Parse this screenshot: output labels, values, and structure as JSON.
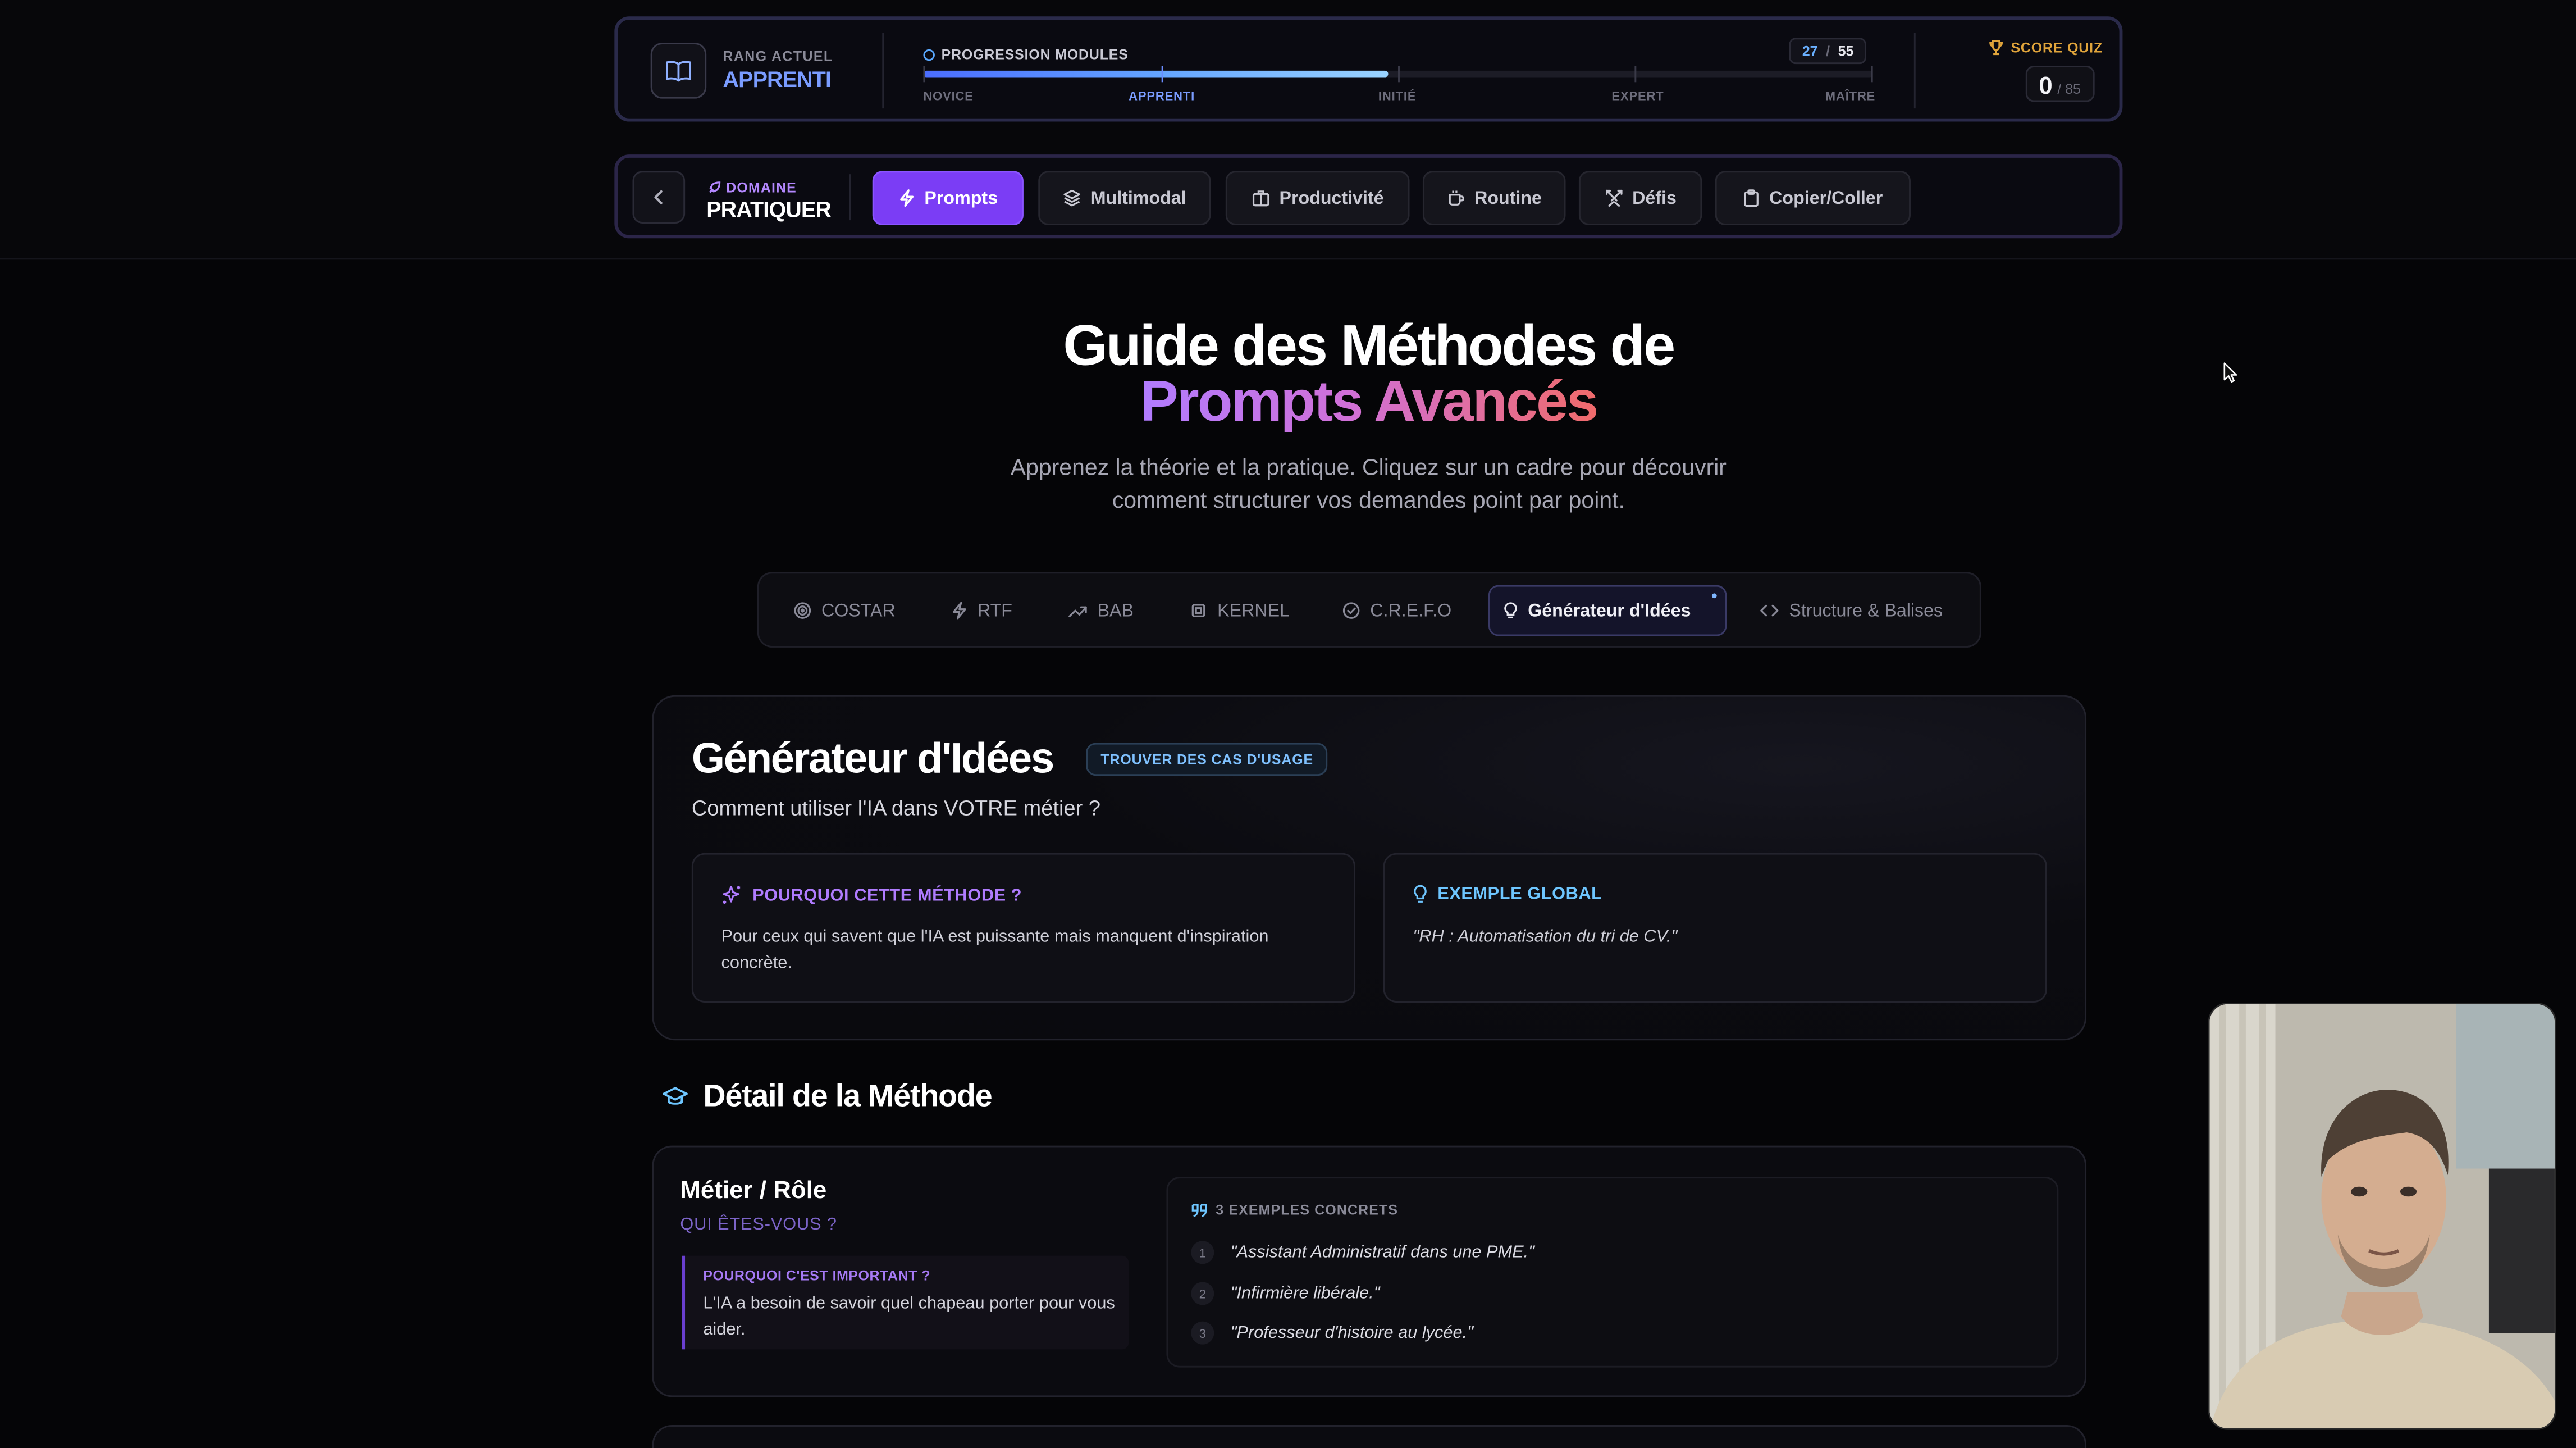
{
  "rank": {
    "label": "RANG ACTUEL",
    "value": "APPRENTI"
  },
  "progress": {
    "label": "PROGRESSION MODULES",
    "current": "27",
    "separator": "/",
    "total": "55",
    "fraction": 0.49,
    "tiers": [
      "NOVICE",
      "APPRENTI",
      "INITIÉ",
      "EXPERT",
      "MAÎTRE"
    ]
  },
  "score": {
    "label": "SCORE QUIZ",
    "value": "0",
    "max": "/ 85"
  },
  "domain": {
    "label": "DOMAINE",
    "value": "PRATIQUER",
    "tabs": [
      {
        "label": "Prompts",
        "icon": "bolt-icon",
        "active": true
      },
      {
        "label": "Multimodal",
        "icon": "layers-icon",
        "active": false
      },
      {
        "label": "Productivité",
        "icon": "briefcase-icon",
        "active": false
      },
      {
        "label": "Routine",
        "icon": "coffee-icon",
        "active": false
      },
      {
        "label": "Défis",
        "icon": "swords-icon",
        "active": false
      },
      {
        "label": "Copier/Coller",
        "icon": "clipboard-icon",
        "active": false
      }
    ]
  },
  "hero": {
    "title_line1": "Guide des Méthodes de",
    "title_line2": "Prompts Avancés",
    "subtitle_line1": "Apprenez la théorie et la pratique. Cliquez sur un cadre pour découvrir",
    "subtitle_line2": "comment structurer vos demandes point par point."
  },
  "method_tabs": [
    {
      "label": "COSTAR",
      "icon": "target-icon"
    },
    {
      "label": "RTF",
      "icon": "bolt-icon"
    },
    {
      "label": "BAB",
      "icon": "trend-up-icon"
    },
    {
      "label": "KERNEL",
      "icon": "cpu-icon"
    },
    {
      "label": "C.R.E.F.O",
      "icon": "check-circle-icon"
    },
    {
      "label": "Générateur d'Idées",
      "icon": "lightbulb-icon",
      "active": true
    },
    {
      "label": "Structure & Balises",
      "icon": "code-icon"
    }
  ],
  "method": {
    "title": "Générateur d'Idées",
    "badge": "TROUVER DES CAS D'USAGE",
    "subtitle": "Comment utiliser l'IA dans VOTRE métier ?",
    "why_title": "POURQUOI CETTE MÉTHODE ?",
    "why_text": "Pour ceux qui savent que l'IA est puissante mais manquent d'inspiration concrète.",
    "example_title": "EXEMPLE GLOBAL",
    "example_text": "\"RH : Automatisation du tri de CV.\""
  },
  "detail": {
    "title": "Détail de la Méthode",
    "role_title": "Métier / Rôle",
    "role_question": "QUI ÊTES-VOUS ?",
    "role_why_head": "POURQUOI C'EST IMPORTANT ?",
    "role_why_text": "L'IA a besoin de savoir quel chapeau porter pour vous aider.",
    "examples_head": "3 EXEMPLES CONCRETS",
    "examples": [
      {
        "num": "1",
        "text": "\"Assistant Administratif dans une PME.\""
      },
      {
        "num": "2",
        "text": "\"Infirmière libérale.\""
      },
      {
        "num": "3",
        "text": "\"Professeur d'histoire au lycée.\""
      }
    ]
  }
}
